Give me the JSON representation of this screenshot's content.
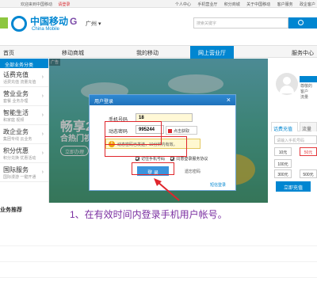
{
  "topbar": {
    "left_text": "欢迎来到中国移动",
    "register": "请登录",
    "links": [
      "个人中心",
      "手机营业厅",
      "积分商城",
      "关于中国移动",
      "客户服务",
      "政企客户"
    ]
  },
  "header": {
    "logo_cn": "中国移动",
    "logo_en": "China Mobile",
    "city": "广州",
    "search_placeholder": "搜索关键字"
  },
  "nav": {
    "items": [
      "首页",
      "移动商城",
      "我的移动",
      "网上营业厅",
      "服务中心"
    ]
  },
  "sidebar": {
    "head": "全部业务分类",
    "items": [
      {
        "title": "话费充值",
        "sub": "话费充值 流量充值"
      },
      {
        "title": "营业业务",
        "sub": "套餐 业务办理"
      },
      {
        "title": "智能生活",
        "sub": "和家庭 视频"
      },
      {
        "title": "政企业务",
        "sub": "集团专线 云业务"
      },
      {
        "title": "积分优惠",
        "sub": "积分兑换 优惠活动"
      },
      {
        "title": "国际服务",
        "sub": "国际漫游 一键开通"
      }
    ]
  },
  "banner": {
    "ad_label": "广告",
    "headline": "畅享2",
    "subline": "合热门视",
    "cta": "立即办理"
  },
  "right_panel": {
    "login_label": "登录",
    "lines": [
      "尊敬的",
      "客户",
      "流量"
    ],
    "tab_active": "话费充值",
    "tab_other": "流量",
    "phone_placeholder": "请输入手机号码",
    "amounts": [
      "10元",
      "50元",
      "100元",
      "300元",
      "500元"
    ],
    "charge_button": "立即充值"
  },
  "recommend": "业务推荐",
  "caption": "1、在有效时间内登录手机用户帐号。",
  "dialog": {
    "title": "用户登录",
    "phone_label": "手机号码",
    "phone_value": "18",
    "code_label": "动态密码",
    "code_value": "995244",
    "get_code": "点击获取",
    "tip": "动态密码已发送，10分钟内有效。",
    "remember": "记住手机号码",
    "agree": "同意登录服务协议",
    "login_button": "登 录",
    "forgot": "遗忘密码",
    "sms_login": "短信登录"
  }
}
